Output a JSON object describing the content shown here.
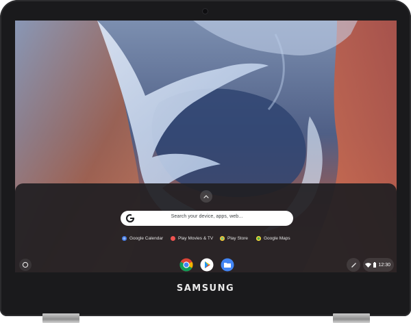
{
  "device": {
    "brand": "SAMSUNG"
  },
  "launcher": {
    "expand_icon": "chevron-up-icon",
    "search": {
      "placeholder": "Search your device, apps, web..."
    },
    "suggestions": [
      {
        "label": "Google Calendar",
        "icon": "google-calendar-icon",
        "color": "#8ab4f8"
      },
      {
        "label": "Play Movies & TV",
        "icon": "play-movies-icon",
        "color": "#ef5350"
      },
      {
        "label": "Play Store",
        "icon": "play-store-icon",
        "color": "#7cc47f"
      },
      {
        "label": "Google Maps",
        "icon": "google-maps-icon",
        "color": "#4caf50"
      }
    ]
  },
  "shelf": {
    "launcher_button_icon": "circle-launcher-icon",
    "apps": [
      {
        "name": "Chrome",
        "icon": "chrome-icon"
      },
      {
        "name": "Play Store",
        "icon": "play-store-icon"
      },
      {
        "name": "Files",
        "icon": "files-icon"
      }
    ],
    "tray": {
      "stylus_icon": "stylus-pen-icon",
      "wifi_icon": "wifi-icon",
      "battery_icon": "battery-icon",
      "time": "12:30"
    }
  },
  "colors": {
    "bezel": "#1a1a1c",
    "launcher_bg": "#201f22",
    "search_bg": "#ffffff",
    "files_blue": "#4285f4"
  }
}
